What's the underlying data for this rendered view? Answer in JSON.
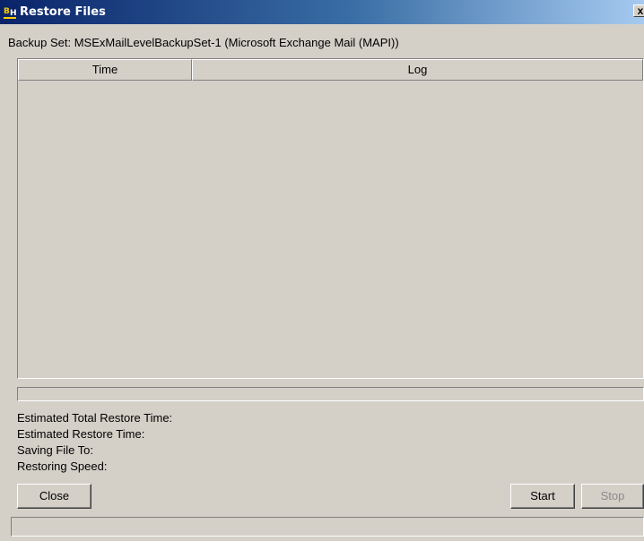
{
  "window": {
    "title": "Restore Files",
    "close_label": "x",
    "app_icon": "backup-app-icon"
  },
  "backup_set": "Backup Set: MSExMailLevelBackupSet-1 (Microsoft Exchange Mail (MAPI))",
  "table": {
    "columns": [
      "Time",
      "Log"
    ],
    "rows": []
  },
  "progress": {
    "value": 0,
    "status_text": ""
  },
  "info": {
    "estimated_total_restore_time": "Estimated Total Restore Time:",
    "estimated_restore_time": "Estimated Restore Time:",
    "saving_file_to": "Saving File To:",
    "restoring_speed": "Restoring Speed:"
  },
  "buttons": {
    "close": "Close",
    "start": "Start",
    "stop": "Stop"
  }
}
